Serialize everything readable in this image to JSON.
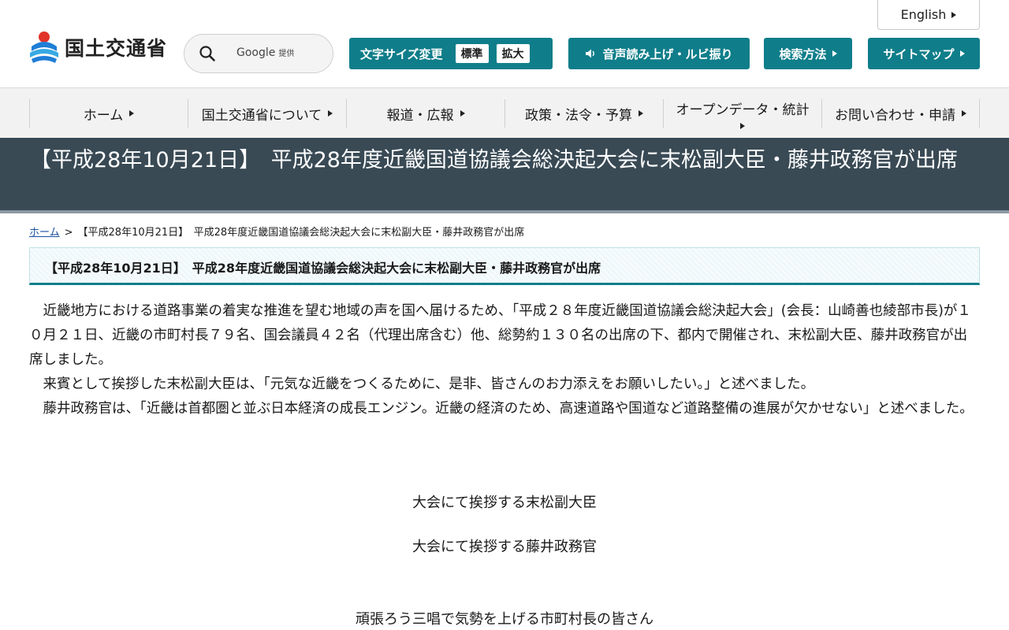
{
  "header": {
    "english_label": "English",
    "logo_text": "国土交通省",
    "search": {
      "placeholder_brand": "Google",
      "placeholder_suffix": "提供"
    },
    "font_size": {
      "label": "文字サイズ変更",
      "normal": "標準",
      "large": "拡大"
    },
    "voice_label": "音声読み上げ・ルビ振り",
    "search_method_label": "検索方法",
    "sitemap_label": "サイトマップ"
  },
  "nav": {
    "items": [
      {
        "label": "ホーム"
      },
      {
        "label": "国土交通省について"
      },
      {
        "label": "報道・広報"
      },
      {
        "label": "政策・法令・予算"
      },
      {
        "label": "オープンデータ・統計"
      },
      {
        "label": "お問い合わせ・申請"
      }
    ]
  },
  "page": {
    "title": "【平成28年10月21日】　平成28年度近畿国道協議会総決起大会に末松副大臣・藤井政務官が出席",
    "breadcrumb": {
      "home": "ホーム",
      "separator": ">",
      "current": "【平成28年10月21日】　平成28年度近畿国道協議会総決起大会に末松副大臣・藤井政務官が出席"
    },
    "heading": "【平成28年10月21日】　平成28年度近畿国道協議会総決起大会に末松副大臣・藤井政務官が出席",
    "paragraphs": [
      "近畿地方における道路事業の着実な推進を望む地域の声を国へ届けるため、「平成２８年度近畿国道協議会総決起大会」(会長：山崎善也綾部市長)が１０月２１日、近畿の市町村長７９名、国会議員４２名（代理出席含む）他、総勢約１３０名の出席の下、都内で開催され、末松副大臣、藤井政務官が出席しました。",
      "来賓として挨拶した末松副大臣は、「元気な近畿をつくるために、是非、皆さんのお力添えをお願いしたい。」と述べました。",
      "藤井政務官は、「近畿は首都圏と並ぶ日本経済の成長エンジン。近畿の経済のため、高速道路や国道など道路整備の進展が欠かせない」と述べました。"
    ],
    "captions": [
      "大会にて挨拶する末松副大臣",
      "大会にて挨拶する藤井政務官",
      "頑張ろう三唱で気勢を上げる市町村長の皆さん"
    ]
  },
  "colors": {
    "accent_teal": "#0f7e8a",
    "title_band": "#394a55",
    "link_blue": "#1a4fa0"
  }
}
